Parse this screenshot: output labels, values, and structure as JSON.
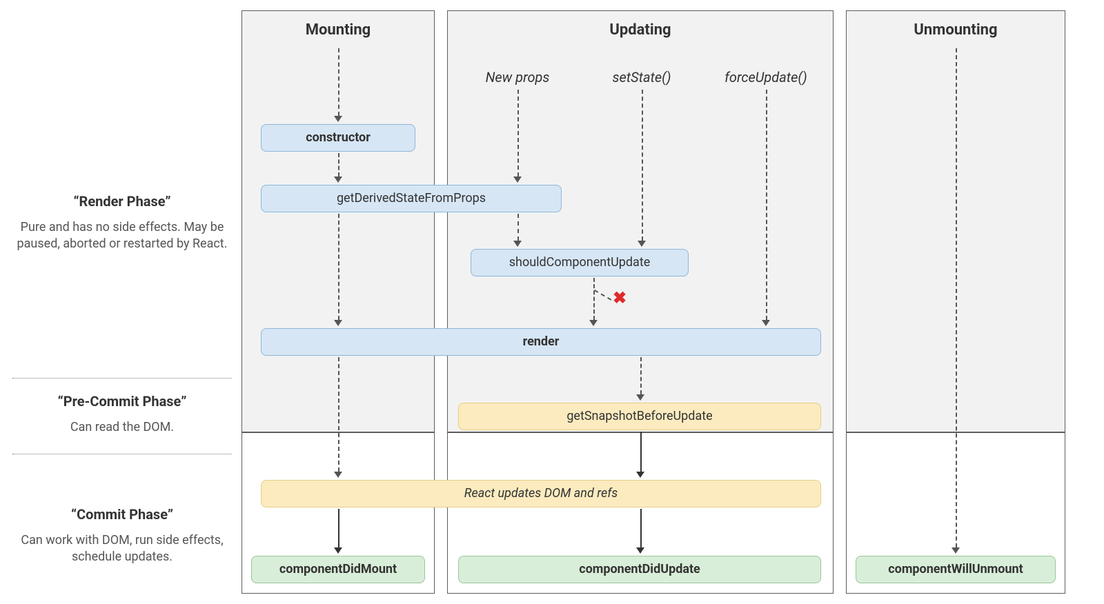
{
  "columns": {
    "mounting": {
      "title": "Mounting"
    },
    "updating": {
      "title": "Updating"
    },
    "unmounting": {
      "title": "Unmounting"
    }
  },
  "phases": {
    "render": {
      "title": "“Render Phase”",
      "desc": "Pure and has no side effects. May be paused, aborted or restarted by React."
    },
    "precommit": {
      "title": "“Pre-Commit Phase”",
      "desc": "Can read the DOM."
    },
    "commit": {
      "title": "“Commit Phase”",
      "desc": "Can work with DOM, run side effects, schedule updates."
    }
  },
  "triggers": {
    "newprops": "New props",
    "setstate": "setState()",
    "forceupdate": "forceUpdate()"
  },
  "lifecycle": {
    "constructor": "constructor",
    "getDerivedStateFromProps": "getDerivedStateFromProps",
    "shouldComponentUpdate": "shouldComponentUpdate",
    "render": "render",
    "getSnapshotBeforeUpdate": "getSnapshotBeforeUpdate",
    "reactUpdatesDomRefs": "React updates DOM and refs",
    "componentDidMount": "componentDidMount",
    "componentDidUpdate": "componentDidUpdate",
    "componentWillUnmount": "componentWillUnmount"
  },
  "mark": {
    "x": "✖"
  }
}
